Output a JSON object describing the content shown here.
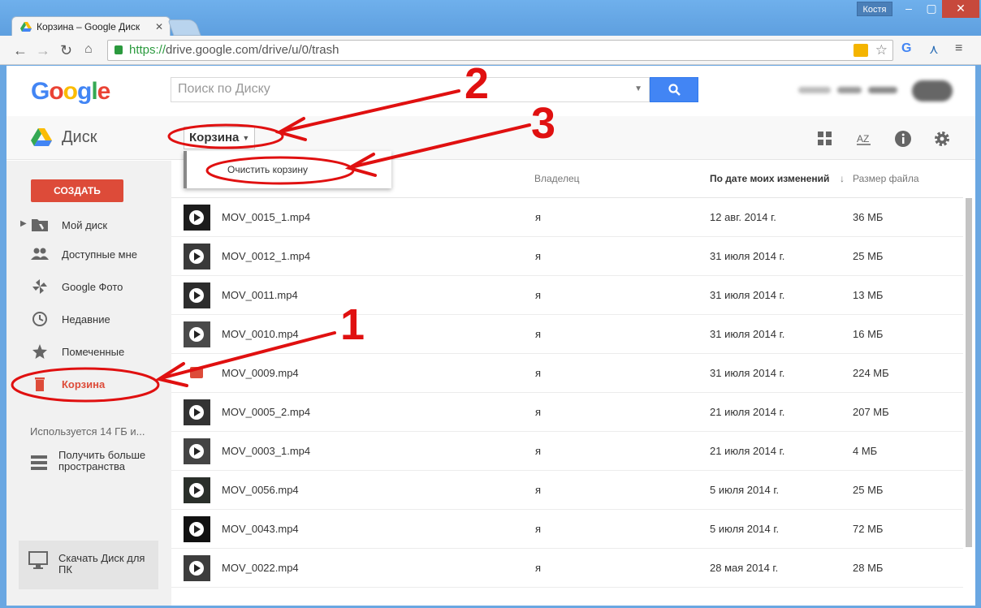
{
  "browser": {
    "tab_title": "Корзина – Google Диск",
    "user_name": "Костя",
    "url_proto": "https://",
    "url_rest": "drive.google.com/drive/u/0/trash"
  },
  "header": {
    "logo": "Google",
    "search_placeholder": "Поиск по Диску"
  },
  "subbar": {
    "app_title": "Диск",
    "breadcrumb": "Корзина",
    "dropdown_item": "Очистить корзину"
  },
  "sidebar": {
    "create_label": "СОЗДАТЬ",
    "items": [
      {
        "label": "Мой диск",
        "icon": "my-drive-icon"
      },
      {
        "label": "Доступные мне",
        "icon": "shared-people-icon"
      },
      {
        "label": "Google Фото",
        "icon": "photos-pinwheel-icon"
      },
      {
        "label": "Недавние",
        "icon": "clock-icon"
      },
      {
        "label": "Помеченные",
        "icon": "star-icon"
      },
      {
        "label": "Корзина",
        "icon": "trash-icon"
      }
    ],
    "storage": "Используется 14 ГБ и...",
    "more_space": "Получить больше пространства",
    "download": "Скачать Диск для ПК"
  },
  "list": {
    "columns": {
      "owner": "Владелец",
      "modified": "По дате моих изменений",
      "sort_arrow": "↓",
      "size": "Размер файла"
    },
    "rows": [
      {
        "name": "MOV_0015_1.mp4",
        "owner": "я",
        "date": "12 авг. 2014 г.",
        "size": "36 МБ"
      },
      {
        "name": "MOV_0012_1.mp4",
        "owner": "я",
        "date": "31 июля 2014 г.",
        "size": "25 МБ"
      },
      {
        "name": "MOV_0011.mp4",
        "owner": "я",
        "date": "31 июля 2014 г.",
        "size": "13 МБ"
      },
      {
        "name": "MOV_0010.mp4",
        "owner": "я",
        "date": "31 июля 2014 г.",
        "size": "16 МБ"
      },
      {
        "name": "MOV_0009.mp4",
        "owner": "я",
        "date": "31 июля 2014 г.",
        "size": "224 МБ"
      },
      {
        "name": "MOV_0005_2.mp4",
        "owner": "я",
        "date": "21 июля 2014 г.",
        "size": "207 МБ"
      },
      {
        "name": "MOV_0003_1.mp4",
        "owner": "я",
        "date": "21 июля 2014 г.",
        "size": "4 МБ"
      },
      {
        "name": "MOV_0056.mp4",
        "owner": "я",
        "date": "5 июля 2014 г.",
        "size": "25 МБ"
      },
      {
        "name": "MOV_0043.mp4",
        "owner": "я",
        "date": "5 июля 2014 г.",
        "size": "72 МБ"
      },
      {
        "name": "MOV_0022.mp4",
        "owner": "я",
        "date": "28 мая 2014 г.",
        "size": "28 МБ"
      }
    ]
  },
  "annotations": {
    "n1": "1",
    "n2": "2",
    "n3": "3",
    "color": "#e01010"
  }
}
